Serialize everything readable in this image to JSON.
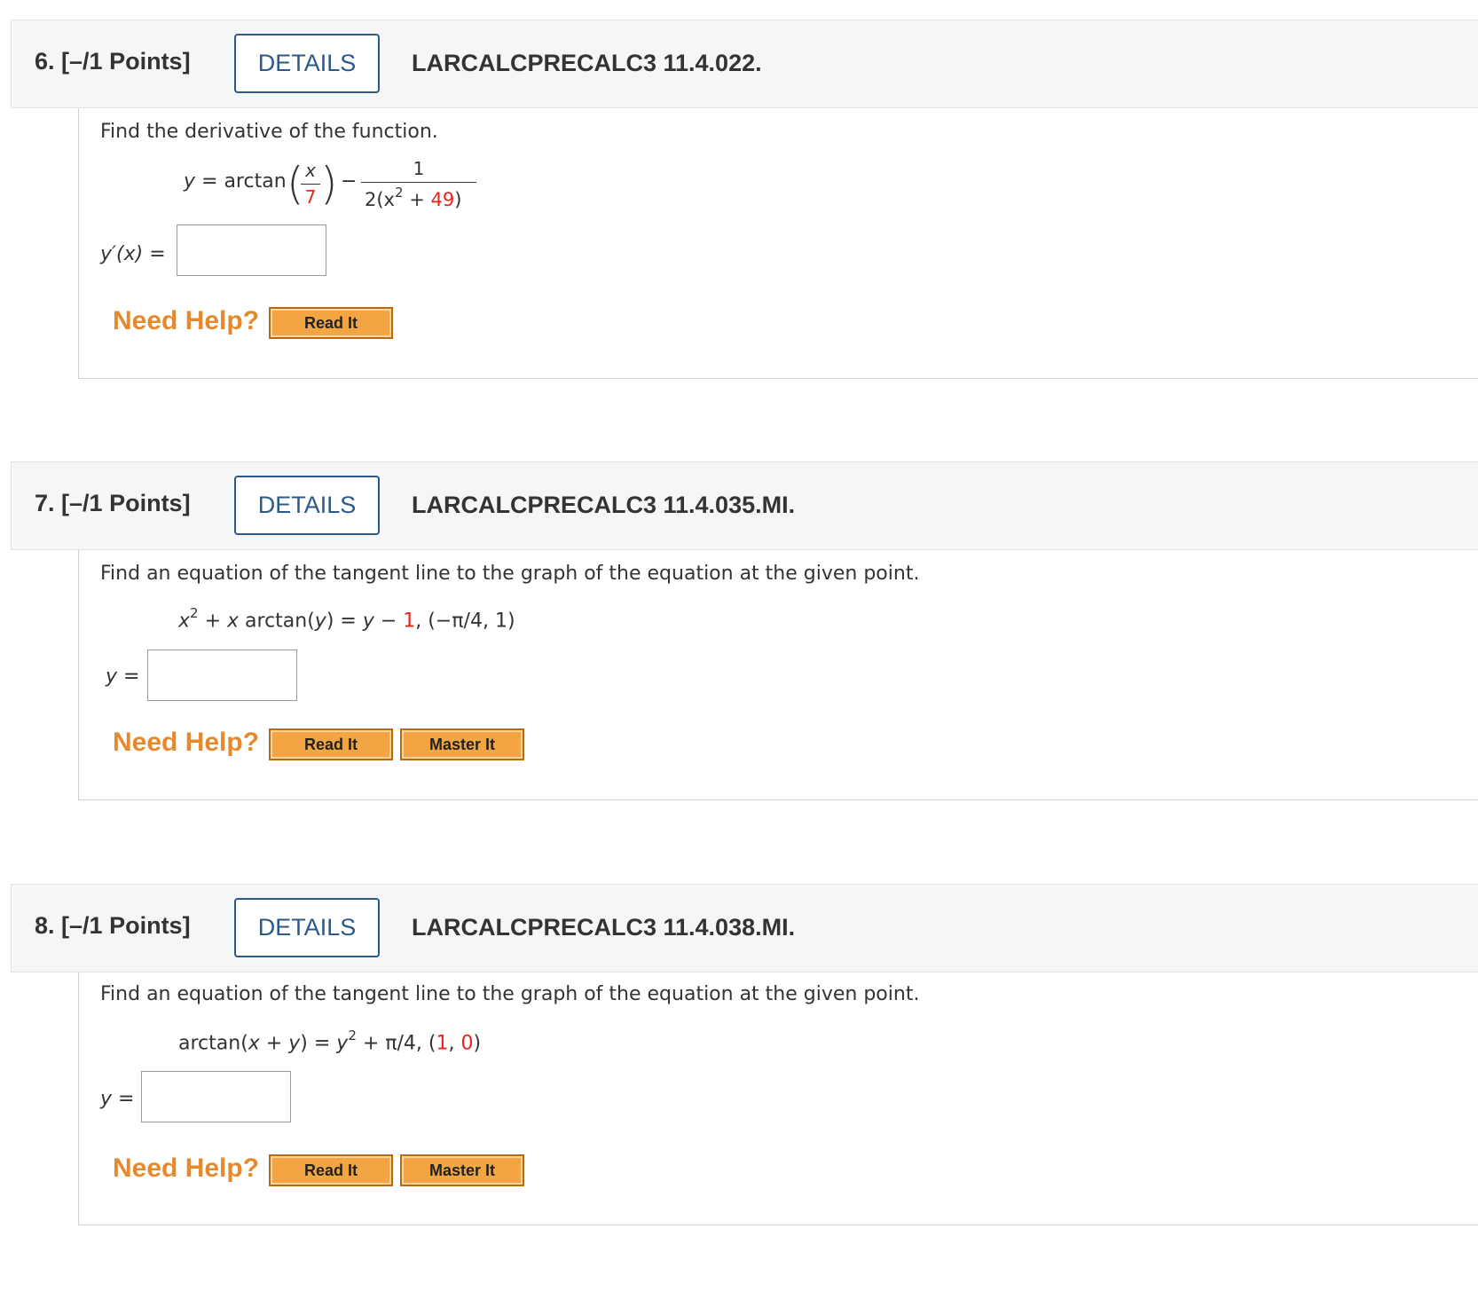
{
  "questions": [
    {
      "number": "6.",
      "points": "[–/1 Points]",
      "details_label": "DETAILS",
      "code": "LARCALCPRECALC3 11.4.022.",
      "prompt": "Find the derivative of the function.",
      "equation": {
        "lhs": "y = arctan",
        "frac_num": "x",
        "frac_den": "7",
        "minus": "−",
        "rhs_num": "1",
        "rhs_den_a": "2(x",
        "rhs_den_sup": "2",
        "rhs_den_b": " + ",
        "rhs_den_red": "49",
        "rhs_den_c": ")"
      },
      "answer_label": "y′(x) =",
      "answer_value": "",
      "need_help": "Need Help?",
      "buttons": [
        "Read It"
      ]
    },
    {
      "number": "7.",
      "points": "[–/1 Points]",
      "details_label": "DETAILS",
      "code": "LARCALCPRECALC3 11.4.035.MI.",
      "prompt": "Find an equation of the tangent line to the graph of the equation at the given point.",
      "equation": {
        "a": "x",
        "sup": "2",
        "b": " + ",
        "c": "x",
        "d": " arctan(",
        "e": "y",
        "f": ") = ",
        "g": "y",
        "h": " − ",
        "red": "1",
        "i": ",    (−π/4, 1)"
      },
      "answer_label": "y =",
      "answer_value": "",
      "need_help": "Need Help?",
      "buttons": [
        "Read It",
        "Master It"
      ]
    },
    {
      "number": "8.",
      "points": "[–/1 Points]",
      "details_label": "DETAILS",
      "code": "LARCALCPRECALC3 11.4.038.MI.",
      "prompt": "Find an equation of the tangent line to the graph of the equation at the given point.",
      "equation": {
        "a": "arctan(",
        "b": "x",
        "c": " + ",
        "d": "y",
        "e": ") = ",
        "f": "y",
        "sup": "2",
        "g": " + π/4,    (",
        "red1": "1",
        "h": ", ",
        "red2": "0",
        "i": ")"
      },
      "answer_label": "y =",
      "answer_value": "",
      "need_help": "Need Help?",
      "buttons": [
        "Read It",
        "Master It"
      ]
    }
  ],
  "colors": {
    "details_border": "#2b5a8a",
    "need_help": "#e58a2c",
    "highlight_red": "#e8231a",
    "help_button": "#f3a544",
    "header_bg": "#f6f6f6"
  }
}
